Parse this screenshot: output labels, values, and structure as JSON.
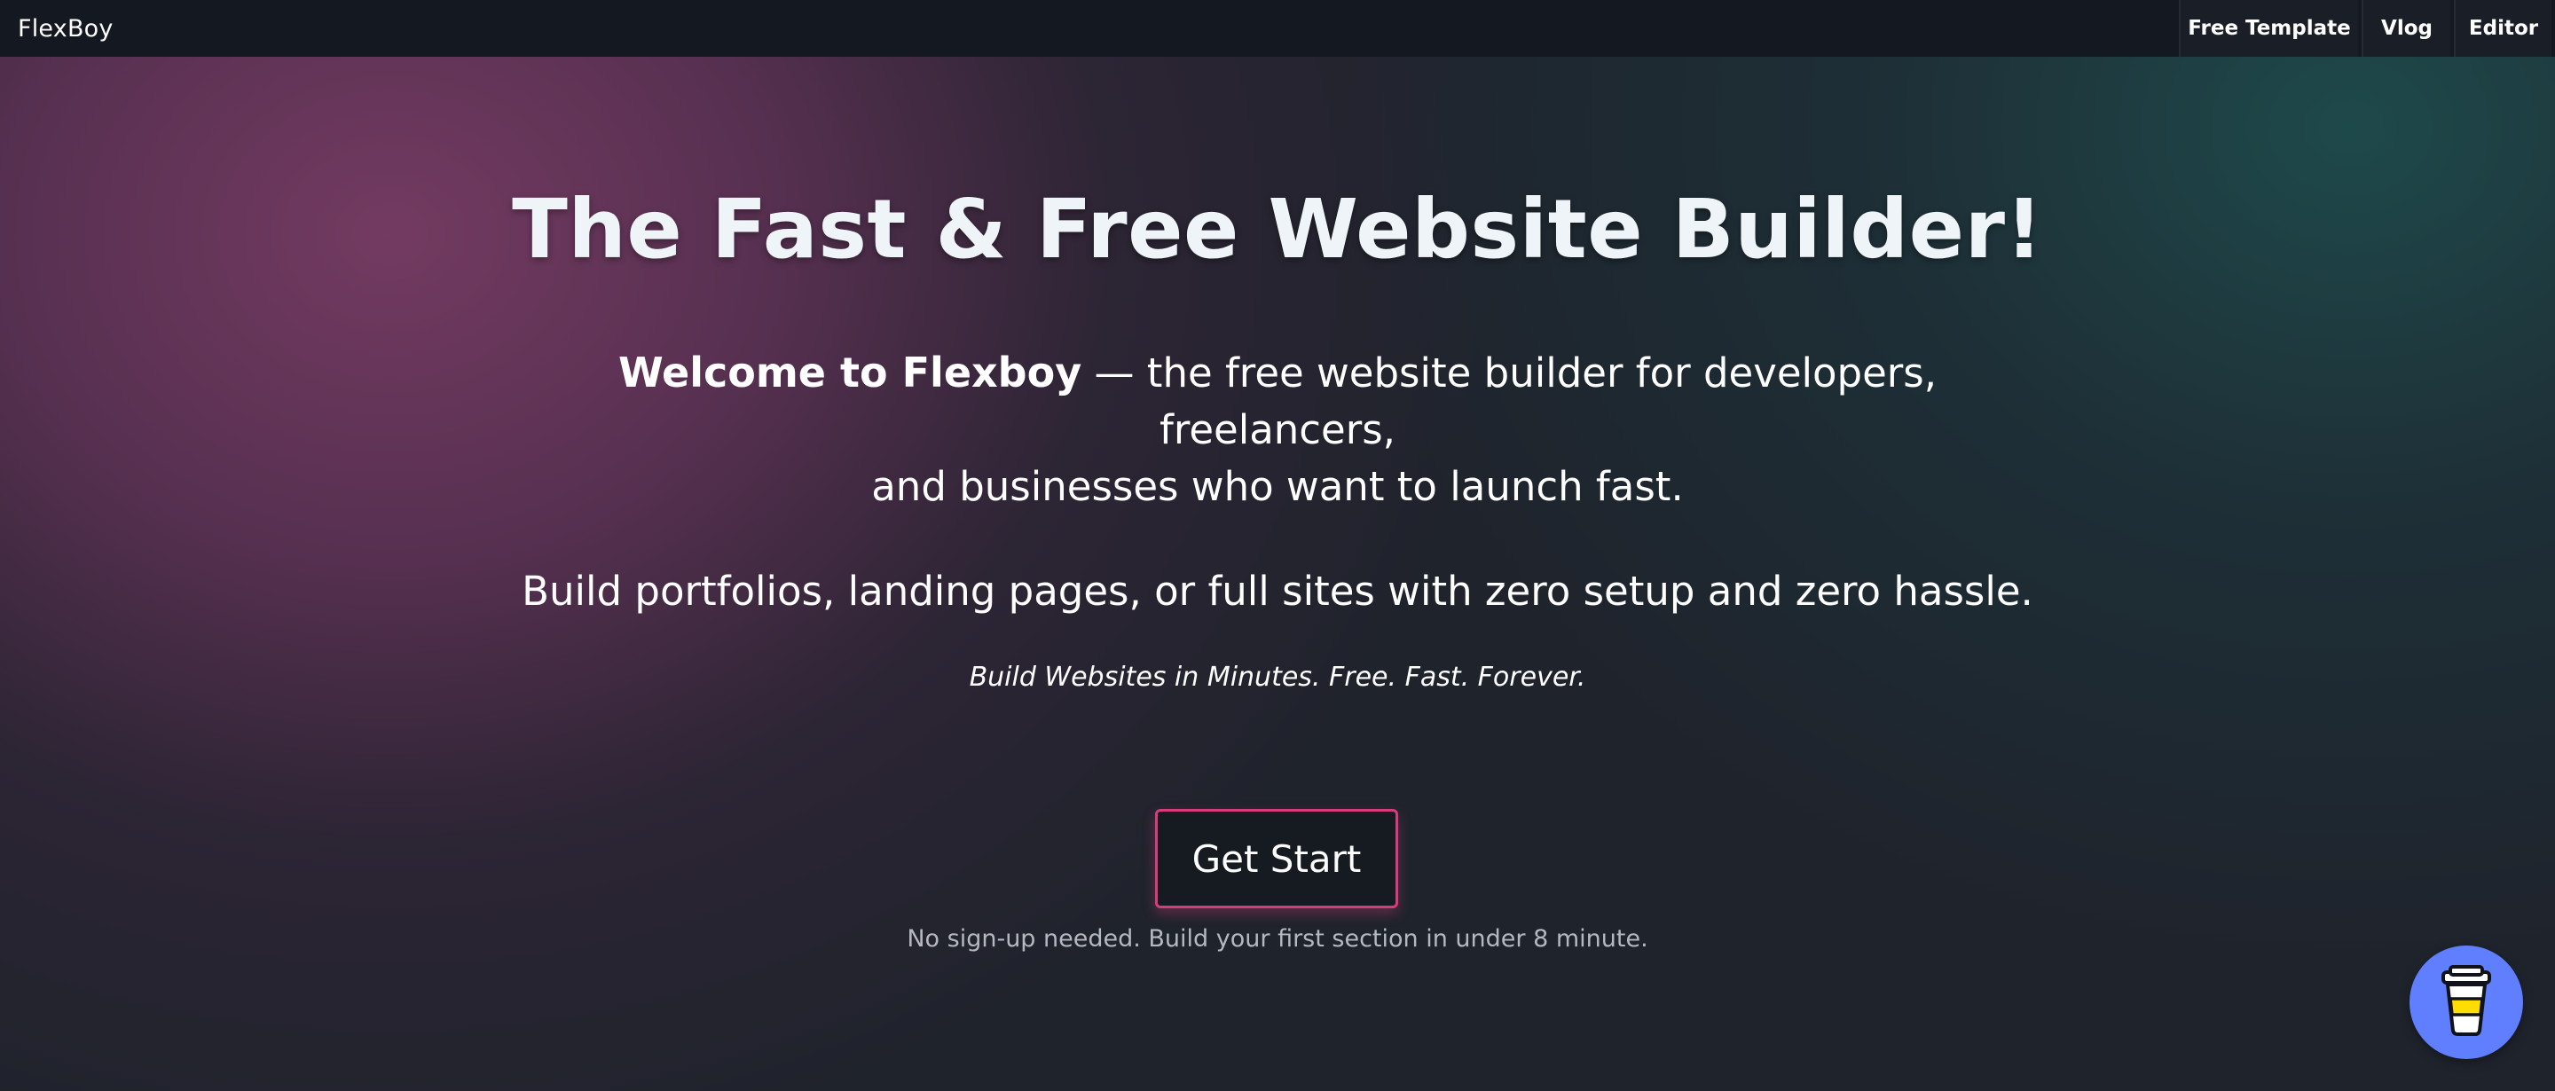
{
  "header": {
    "brand": "FlexBoy",
    "nav": [
      {
        "label": "Free Template"
      },
      {
        "label": "Vlog"
      },
      {
        "label": "Editor"
      }
    ]
  },
  "hero": {
    "title": "The Fast & Free Website Builder!",
    "lead_bold": "Welcome to Flexboy",
    "lead_rest_line1": " — the free website builder for developers, freelancers,",
    "lead_rest_line2": "and businesses who want to launch fast.",
    "subtitle": "Build portfolios, landing pages, or full sites with zero setup and zero hassle.",
    "tagline": "Build Websites in Minutes. Free. Fast. Forever.",
    "cta_label": "Get Start",
    "note": "No sign-up needed. Build your first section in under 8 minute."
  },
  "floating": {
    "icon": "coffee-cup-icon",
    "color": "#5f7fff"
  },
  "colors": {
    "accent": "#d63c7c",
    "topbar": "#141820"
  }
}
